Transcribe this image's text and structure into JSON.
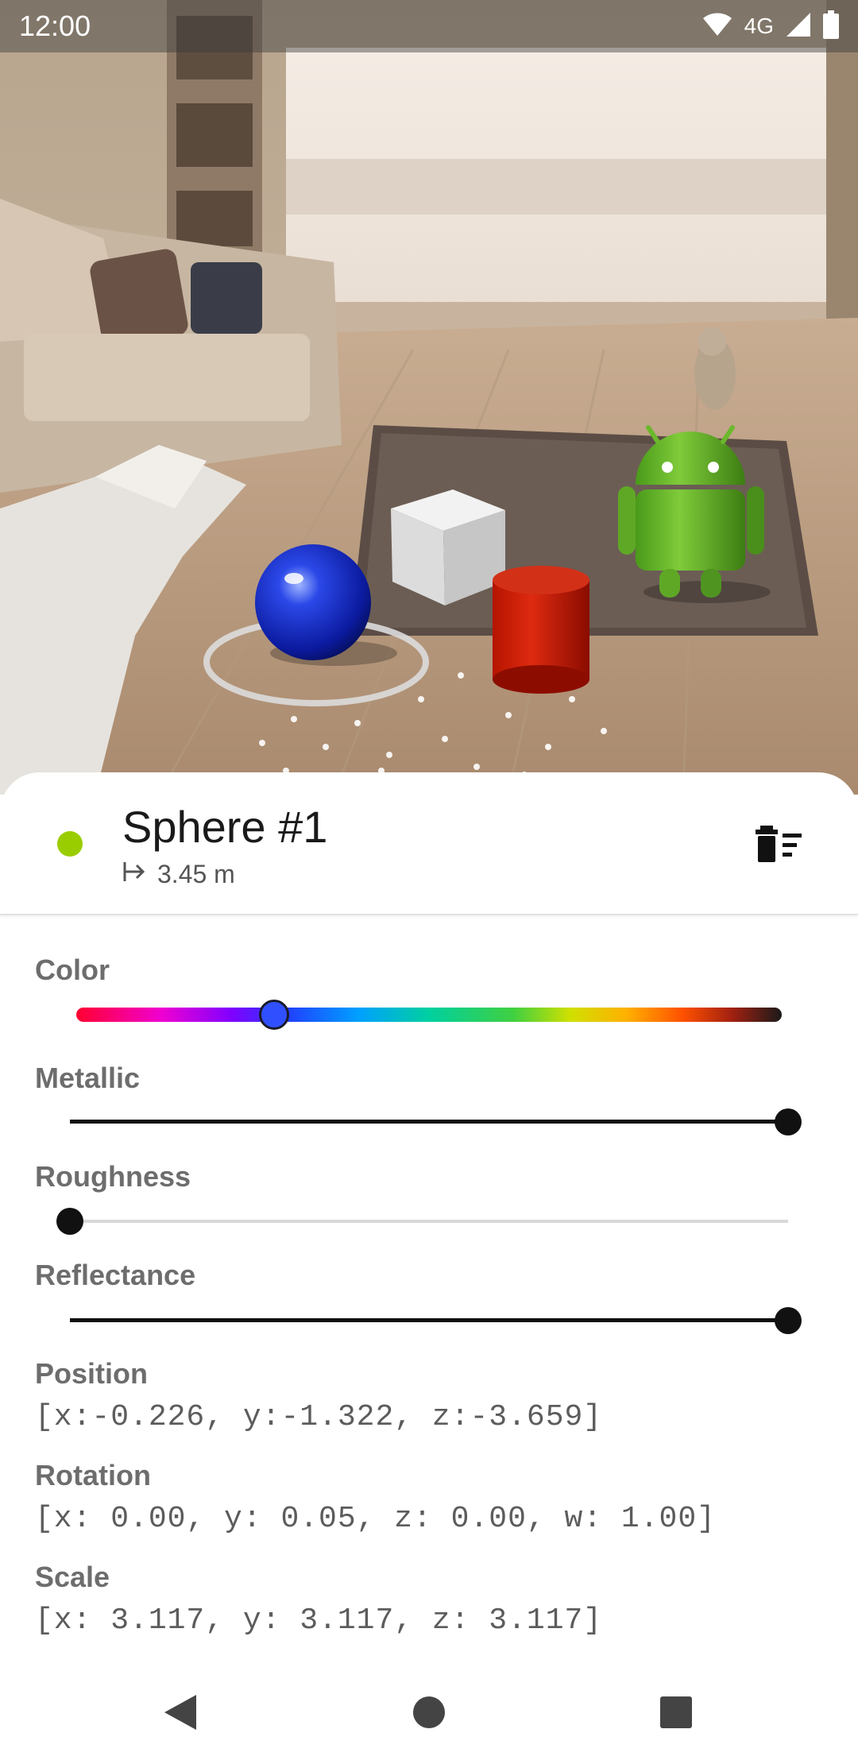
{
  "status_bar": {
    "time": "12:00",
    "network": "4G",
    "icons": [
      "wifi-icon",
      "cell-signal-icon",
      "battery-icon"
    ]
  },
  "object_panel": {
    "title": "Sphere #1",
    "distance": "3.45 m",
    "status_color": "#9acd00",
    "icons": [
      "distance-arrow-icon",
      "delete-sweep-icon"
    ]
  },
  "properties": {
    "color": {
      "label": "Color",
      "hue_fraction": 0.28,
      "swatch": "#3050ff"
    },
    "metallic": {
      "label": "Metallic",
      "value": 1.0
    },
    "roughness": {
      "label": "Roughness",
      "value": 0.0
    },
    "reflectance": {
      "label": "Reflectance",
      "value": 1.0
    }
  },
  "transform": {
    "position_label": "Position",
    "position_value": "[x:-0.226, y:-1.322, z:-3.659]",
    "rotation_label": "Rotation",
    "rotation_value": "[x: 0.00, y: 0.05, z: 0.00, w: 1.00]",
    "scale_label": "Scale",
    "scale_value": "[x: 3.117, y: 3.117, z: 3.117]"
  },
  "nav_bar": {
    "icons": [
      "back-icon",
      "home-icon",
      "recents-icon"
    ]
  }
}
